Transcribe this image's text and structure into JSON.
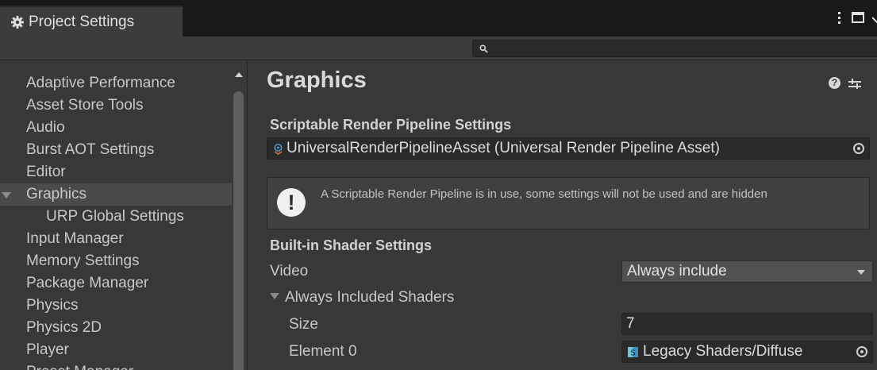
{
  "window": {
    "tab_title": "Project Settings",
    "tab_icon": "gear-icon"
  },
  "search": {
    "value": "",
    "placeholder": ""
  },
  "sidebar": {
    "items": [
      {
        "label": "Adaptive Performance"
      },
      {
        "label": "Asset Store Tools"
      },
      {
        "label": "Audio"
      },
      {
        "label": "Burst AOT Settings"
      },
      {
        "label": "Editor"
      },
      {
        "label": "Graphics",
        "selected": true,
        "expanded": true
      },
      {
        "label": "URP Global Settings",
        "sub": true
      },
      {
        "label": "Input Manager"
      },
      {
        "label": "Memory Settings"
      },
      {
        "label": "Package Manager"
      },
      {
        "label": "Physics"
      },
      {
        "label": "Physics 2D"
      },
      {
        "label": "Player"
      },
      {
        "label": "Preset Manager"
      }
    ]
  },
  "main": {
    "title": "Graphics",
    "srp_section": "Scriptable Render Pipeline Settings",
    "srp_asset": "UniversalRenderPipelineAsset (Universal Render Pipeline Asset)",
    "warning": "A Scriptable Render Pipeline is in use, some settings will not be used and are hidden",
    "builtin_section": "Built-in Shader Settings",
    "video_label": "Video",
    "video_value": "Always include",
    "always_included_label": "Always Included Shaders",
    "size_label": "Size",
    "size_value": "7",
    "element0_label": "Element 0",
    "element0_value": "Legacy Shaders/Diffuse"
  },
  "colors": {
    "titlebar": "#191919",
    "panel": "#383838",
    "field": "#2a2a2a",
    "selected": "#4a4a4a"
  }
}
